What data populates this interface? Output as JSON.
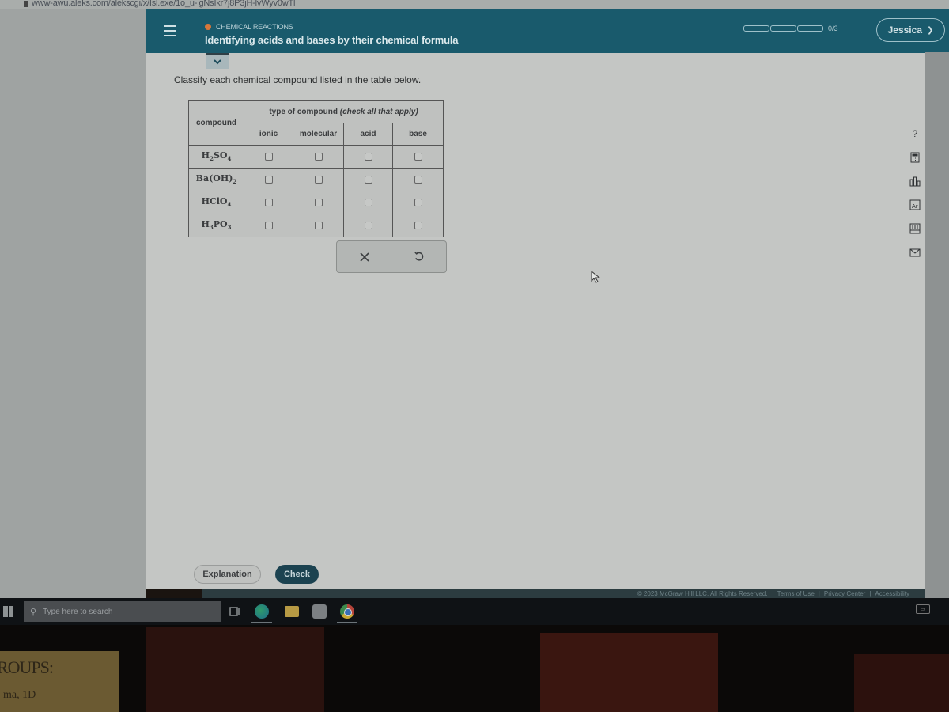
{
  "browser": {
    "url": "www-awu.aleks.com/alekscgi/x/Isl.exe/1o_u-lgNsIkr7j8P3jH-lvWyv0wTl"
  },
  "header": {
    "topic": "CHEMICAL REACTIONS",
    "title": "Identifying acids and bases by their chemical formula",
    "progress": {
      "segments_total": 3,
      "segments_filled": 0,
      "label": "0/3"
    },
    "user_name": "Jessica",
    "accent_color": "#195a6c",
    "topic_dot_color": "#d7773a"
  },
  "main": {
    "instruction": "Classify each chemical compound listed in the table below.",
    "table": {
      "compound_header": "compound",
      "type_header": "type of compound",
      "type_header_note": "(check all that apply)",
      "columns": [
        "ionic",
        "molecular",
        "acid",
        "base"
      ],
      "rows": [
        {
          "formula_parts": [
            {
              "t": "H"
            },
            {
              "s": "2"
            },
            {
              "t": "SO"
            },
            {
              "s": "4"
            }
          ],
          "checked": [
            false,
            false,
            false,
            false
          ]
        },
        {
          "formula_parts": [
            {
              "t": "Ba(OH)"
            },
            {
              "s": "2"
            }
          ],
          "checked": [
            false,
            false,
            false,
            false
          ]
        },
        {
          "formula_parts": [
            {
              "t": "HClO"
            },
            {
              "s": "4"
            }
          ],
          "checked": [
            false,
            false,
            false,
            false
          ]
        },
        {
          "formula_parts": [
            {
              "t": "H"
            },
            {
              "s": "3"
            },
            {
              "t": "PO"
            },
            {
              "s": "3"
            }
          ],
          "checked": [
            false,
            false,
            false,
            false
          ]
        }
      ]
    },
    "actions": {
      "clear_icon": "x-icon",
      "reset_icon": "undo-icon"
    },
    "buttons": {
      "explanation": "Explanation",
      "check": "Check"
    }
  },
  "side_tools": [
    "help-icon",
    "calculator-icon",
    "chart-icon",
    "periodic-table-icon",
    "textbook-icon",
    "message-icon"
  ],
  "side_tools_help_glyph": "?",
  "footer": {
    "copyright": "© 2023 McGraw Hill LLC. All Rights Reserved.",
    "links": [
      "Terms of Use",
      "Privacy Center",
      "Accessibility"
    ]
  },
  "taskbar": {
    "search_placeholder": "Type here to search"
  },
  "desk_note": {
    "line1": "ROUPS:",
    "line2": "ma, 1D"
  }
}
